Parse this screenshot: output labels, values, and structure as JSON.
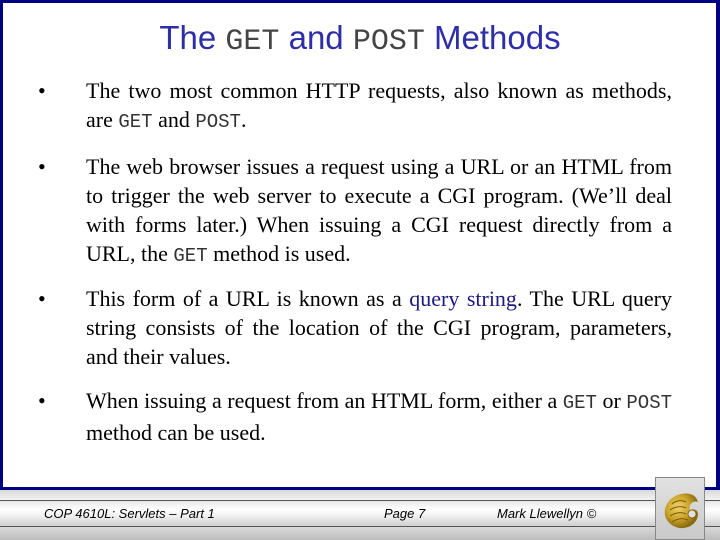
{
  "slide": {
    "title": {
      "part1": "The ",
      "code1": "GET",
      "part2": " and ",
      "code2": "POST",
      "part3": " Methods"
    },
    "bullets": [
      {
        "segments": [
          {
            "text": "The two most common HTTP requests, also known as methods, are ",
            "style": "normal"
          },
          {
            "text": "GET",
            "style": "mono"
          },
          {
            "text": " and ",
            "style": "normal"
          },
          {
            "text": "POST",
            "style": "mono"
          },
          {
            "text": ".",
            "style": "normal"
          }
        ]
      },
      {
        "segments": [
          {
            "text": "The web browser issues a request using a URL or an HTML from to trigger the web server to execute a CGI program. (We’ll deal with forms later.)  When issuing a CGI request directly from a URL, the ",
            "style": "normal"
          },
          {
            "text": "GET",
            "style": "mono"
          },
          {
            "text": " method is used.",
            "style": "normal"
          }
        ]
      },
      {
        "segments": [
          {
            "text": "This form of a URL is known as a ",
            "style": "normal"
          },
          {
            "text": "query string",
            "style": "hl"
          },
          {
            "text": ".  The URL query string consists of the location of the CGI program, parameters, and their values.",
            "style": "normal"
          }
        ]
      },
      {
        "segments": [
          {
            "text": "When issuing a request from an HTML form, either a ",
            "style": "normal"
          },
          {
            "text": "GET",
            "style": "mono"
          },
          {
            "text": " or ",
            "style": "normal"
          },
          {
            "text": "POST",
            "style": "mono"
          },
          {
            "text": " method can be used.",
            "style": "normal"
          }
        ]
      }
    ],
    "bullet_glyph": "•"
  },
  "footer": {
    "course": "COP 4610L: Servlets – Part 1",
    "page": "Page 7",
    "author": "Mark Llewellyn ©",
    "logo_icon": "ucf-pegasus-logo-icon"
  },
  "colors": {
    "border": "#000080",
    "title": "#2e2ea8",
    "highlight": "#1a1a80",
    "logo_gold": "#c9a227"
  }
}
